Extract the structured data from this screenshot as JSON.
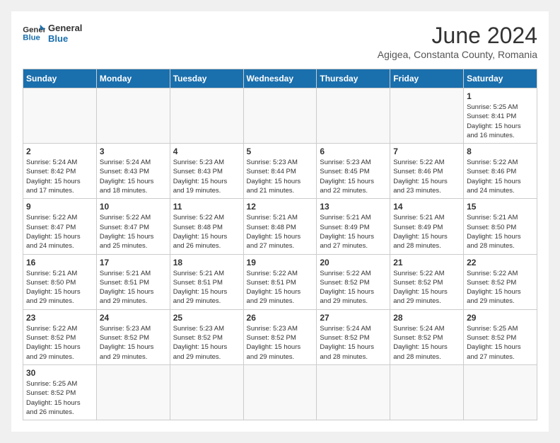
{
  "logo": {
    "general": "General",
    "blue": "Blue"
  },
  "header": {
    "month": "June 2024",
    "location": "Agigea, Constanta County, Romania"
  },
  "weekdays": [
    "Sunday",
    "Monday",
    "Tuesday",
    "Wednesday",
    "Thursday",
    "Friday",
    "Saturday"
  ],
  "weeks": [
    [
      {
        "day": "",
        "info": ""
      },
      {
        "day": "",
        "info": ""
      },
      {
        "day": "",
        "info": ""
      },
      {
        "day": "",
        "info": ""
      },
      {
        "day": "",
        "info": ""
      },
      {
        "day": "",
        "info": ""
      },
      {
        "day": "1",
        "info": "Sunrise: 5:25 AM\nSunset: 8:41 PM\nDaylight: 15 hours and 16 minutes."
      }
    ],
    [
      {
        "day": "2",
        "info": "Sunrise: 5:24 AM\nSunset: 8:42 PM\nDaylight: 15 hours and 17 minutes."
      },
      {
        "day": "3",
        "info": "Sunrise: 5:24 AM\nSunset: 8:43 PM\nDaylight: 15 hours and 18 minutes."
      },
      {
        "day": "4",
        "info": "Sunrise: 5:23 AM\nSunset: 8:43 PM\nDaylight: 15 hours and 19 minutes."
      },
      {
        "day": "5",
        "info": "Sunrise: 5:23 AM\nSunset: 8:44 PM\nDaylight: 15 hours and 21 minutes."
      },
      {
        "day": "6",
        "info": "Sunrise: 5:23 AM\nSunset: 8:45 PM\nDaylight: 15 hours and 22 minutes."
      },
      {
        "day": "7",
        "info": "Sunrise: 5:22 AM\nSunset: 8:46 PM\nDaylight: 15 hours and 23 minutes."
      },
      {
        "day": "8",
        "info": "Sunrise: 5:22 AM\nSunset: 8:46 PM\nDaylight: 15 hours and 24 minutes."
      }
    ],
    [
      {
        "day": "9",
        "info": "Sunrise: 5:22 AM\nSunset: 8:47 PM\nDaylight: 15 hours and 24 minutes."
      },
      {
        "day": "10",
        "info": "Sunrise: 5:22 AM\nSunset: 8:47 PM\nDaylight: 15 hours and 25 minutes."
      },
      {
        "day": "11",
        "info": "Sunrise: 5:22 AM\nSunset: 8:48 PM\nDaylight: 15 hours and 26 minutes."
      },
      {
        "day": "12",
        "info": "Sunrise: 5:21 AM\nSunset: 8:48 PM\nDaylight: 15 hours and 27 minutes."
      },
      {
        "day": "13",
        "info": "Sunrise: 5:21 AM\nSunset: 8:49 PM\nDaylight: 15 hours and 27 minutes."
      },
      {
        "day": "14",
        "info": "Sunrise: 5:21 AM\nSunset: 8:49 PM\nDaylight: 15 hours and 28 minutes."
      },
      {
        "day": "15",
        "info": "Sunrise: 5:21 AM\nSunset: 8:50 PM\nDaylight: 15 hours and 28 minutes."
      }
    ],
    [
      {
        "day": "16",
        "info": "Sunrise: 5:21 AM\nSunset: 8:50 PM\nDaylight: 15 hours and 29 minutes."
      },
      {
        "day": "17",
        "info": "Sunrise: 5:21 AM\nSunset: 8:51 PM\nDaylight: 15 hours and 29 minutes."
      },
      {
        "day": "18",
        "info": "Sunrise: 5:21 AM\nSunset: 8:51 PM\nDaylight: 15 hours and 29 minutes."
      },
      {
        "day": "19",
        "info": "Sunrise: 5:22 AM\nSunset: 8:51 PM\nDaylight: 15 hours and 29 minutes."
      },
      {
        "day": "20",
        "info": "Sunrise: 5:22 AM\nSunset: 8:52 PM\nDaylight: 15 hours and 29 minutes."
      },
      {
        "day": "21",
        "info": "Sunrise: 5:22 AM\nSunset: 8:52 PM\nDaylight: 15 hours and 29 minutes."
      },
      {
        "day": "22",
        "info": "Sunrise: 5:22 AM\nSunset: 8:52 PM\nDaylight: 15 hours and 29 minutes."
      }
    ],
    [
      {
        "day": "23",
        "info": "Sunrise: 5:22 AM\nSunset: 8:52 PM\nDaylight: 15 hours and 29 minutes."
      },
      {
        "day": "24",
        "info": "Sunrise: 5:23 AM\nSunset: 8:52 PM\nDaylight: 15 hours and 29 minutes."
      },
      {
        "day": "25",
        "info": "Sunrise: 5:23 AM\nSunset: 8:52 PM\nDaylight: 15 hours and 29 minutes."
      },
      {
        "day": "26",
        "info": "Sunrise: 5:23 AM\nSunset: 8:52 PM\nDaylight: 15 hours and 29 minutes."
      },
      {
        "day": "27",
        "info": "Sunrise: 5:24 AM\nSunset: 8:52 PM\nDaylight: 15 hours and 28 minutes."
      },
      {
        "day": "28",
        "info": "Sunrise: 5:24 AM\nSunset: 8:52 PM\nDaylight: 15 hours and 28 minutes."
      },
      {
        "day": "29",
        "info": "Sunrise: 5:25 AM\nSunset: 8:52 PM\nDaylight: 15 hours and 27 minutes."
      }
    ],
    [
      {
        "day": "30",
        "info": "Sunrise: 5:25 AM\nSunset: 8:52 PM\nDaylight: 15 hours and 26 minutes."
      },
      {
        "day": "",
        "info": ""
      },
      {
        "day": "",
        "info": ""
      },
      {
        "day": "",
        "info": ""
      },
      {
        "day": "",
        "info": ""
      },
      {
        "day": "",
        "info": ""
      },
      {
        "day": "",
        "info": ""
      }
    ]
  ]
}
